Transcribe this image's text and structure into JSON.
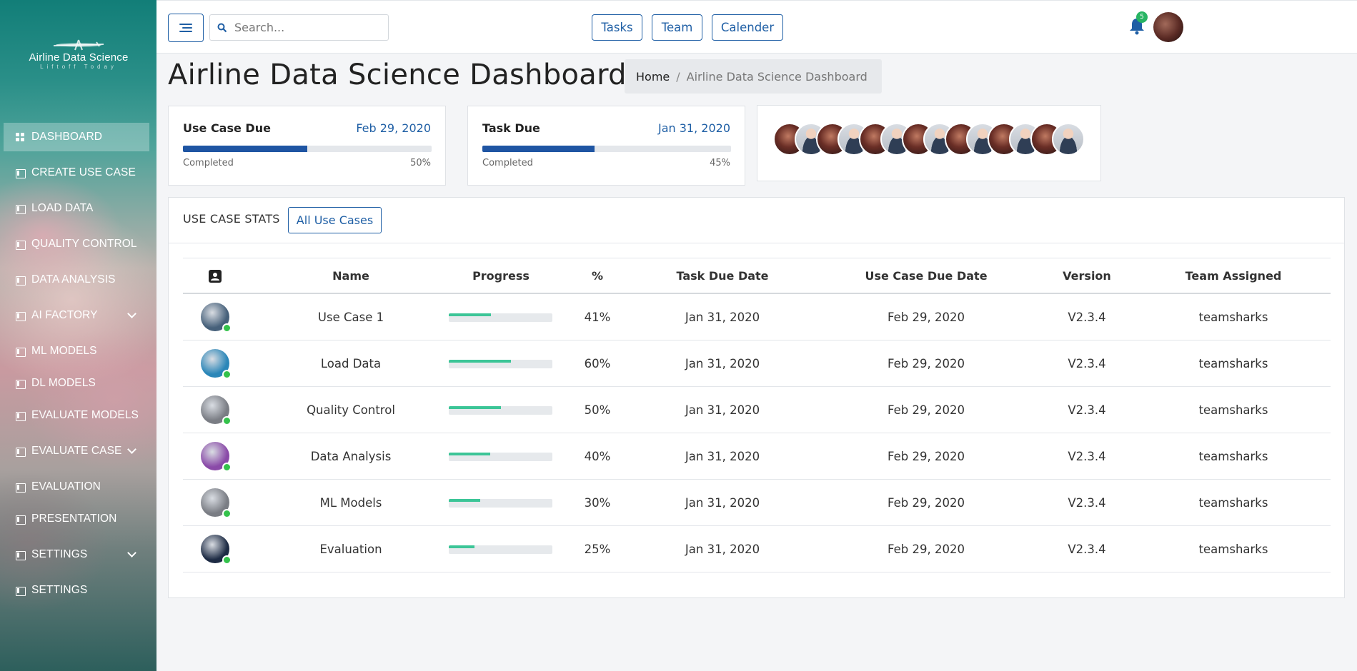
{
  "sidebar": {
    "logo_title": "Airline Data Science",
    "logo_sub": "Liftoff Today",
    "items": [
      {
        "label": "DASHBOARD"
      },
      {
        "label": "CREATE USE CASE"
      },
      {
        "label": "LOAD DATA"
      },
      {
        "label": "QUALITY CONTROL"
      },
      {
        "label": "DATA ANALYSIS"
      },
      {
        "label": "AI FACTORY"
      },
      {
        "label": "ML MODELS"
      },
      {
        "label": "DL MODELS"
      },
      {
        "label": "EVALUATE MODELS"
      },
      {
        "label": "EVALUATE CASE"
      },
      {
        "label": "EVALUATION"
      },
      {
        "label": "PRESENTATION"
      },
      {
        "label": "SETTINGS"
      },
      {
        "label": "SETTINGS"
      }
    ]
  },
  "topbar": {
    "search_placeholder": "Search...",
    "buttons": [
      "Tasks",
      "Team",
      "Calender"
    ],
    "notification_count": "5"
  },
  "page": {
    "title": "Airline Data Science Dashboard",
    "breadcrumb_home": "Home",
    "breadcrumb_current": "Airline Data Science Dashboard"
  },
  "cards": {
    "use_case": {
      "label": "Use Case Due",
      "date": "Feb 29, 2020",
      "status": "Completed",
      "percent": "50%",
      "progress": 0.5
    },
    "task": {
      "label": "Task Due",
      "date": "Jan 31, 2020",
      "status": "Completed",
      "percent": "45%",
      "progress": 0.45
    }
  },
  "team_avatars": [
    "plane",
    "face",
    "plane",
    "face",
    "plane",
    "face",
    "plane",
    "face",
    "plane",
    "face",
    "plane",
    "face",
    "plane",
    "face"
  ],
  "stats": {
    "title": "USE CASE STATS",
    "button": "All Use Cases",
    "headers": [
      "Name",
      "Progress",
      "%",
      "Task Due Date",
      "Use Case Due Date",
      "Version",
      "Team Assigned"
    ],
    "rows": [
      {
        "name": "Use Case 1",
        "progress": 0.41,
        "pct": "41%",
        "task_due": "Jan 31, 2020",
        "use_case_due": "Feb 29, 2020",
        "version": "V2.3.4",
        "team": "teamsharks",
        "avatar": "#46607a"
      },
      {
        "name": "Load Data",
        "progress": 0.6,
        "pct": "60%",
        "task_due": "Jan 31, 2020",
        "use_case_due": "Feb 29, 2020",
        "version": "V2.3.4",
        "team": "teamsharks",
        "avatar": "#2a86b8"
      },
      {
        "name": "Quality Control",
        "progress": 0.5,
        "pct": "50%",
        "task_due": "Jan 31, 2020",
        "use_case_due": "Feb 29, 2020",
        "version": "V2.3.4",
        "team": "teamsharks",
        "avatar": "#7a7d84"
      },
      {
        "name": "Data Analysis",
        "progress": 0.4,
        "pct": "40%",
        "task_due": "Jan 31, 2020",
        "use_case_due": "Feb 29, 2020",
        "version": "V2.3.4",
        "team": "teamsharks",
        "avatar": "#8a4aa8"
      },
      {
        "name": "ML Models",
        "progress": 0.3,
        "pct": "30%",
        "task_due": "Jan 31, 2020",
        "use_case_due": "Feb 29, 2020",
        "version": "V2.3.4",
        "team": "teamsharks",
        "avatar": "#7a7d84"
      },
      {
        "name": "Evaluation",
        "progress": 0.25,
        "pct": "25%",
        "task_due": "Jan 31, 2020",
        "use_case_due": "Feb 29, 2020",
        "version": "V2.3.4",
        "team": "teamsharks",
        "avatar": "#1d2b44"
      }
    ]
  }
}
